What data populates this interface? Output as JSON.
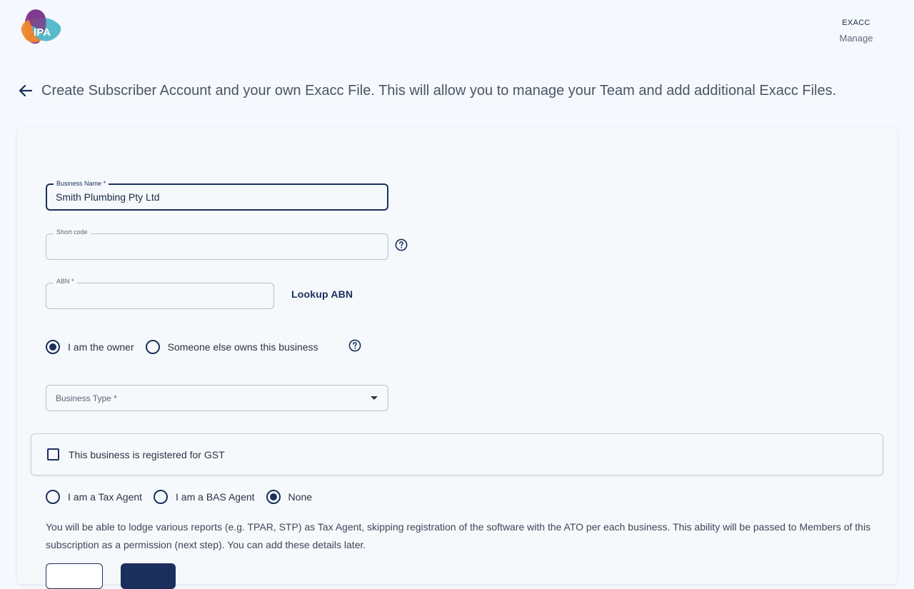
{
  "header": {
    "logo_text": "IPA",
    "org_name": "EXACC",
    "manage_link": "Manage"
  },
  "page": {
    "title": "Create Subscriber Account and your own Exacc File. This will allow you to manage your Team and add additional Exacc Files."
  },
  "form": {
    "business_name": {
      "label": "Business Name *",
      "value": "Smith Plumbing Pty Ltd"
    },
    "short_code": {
      "label": "Short code",
      "value": ""
    },
    "abn": {
      "label": "ABN *",
      "value": ""
    },
    "lookup_abn_label": "Lookup ABN",
    "ownership": {
      "options": [
        "I am the owner",
        "Someone else owns this business"
      ],
      "selected": "I am the owner"
    },
    "business_type": {
      "placeholder": "Business Type *"
    },
    "gst": {
      "label": "This business is registered for GST",
      "checked": false
    },
    "agent": {
      "options": [
        "I am a Tax Agent",
        "I am a BAS Agent",
        "None"
      ],
      "selected": "None"
    },
    "info_text": "You will be able to lodge various reports (e.g. TPAR, STP) as Tax Agent, skipping registration of the software with the ATO per each business. This ability will be passed to Members of this subscription as a permission (next step). You can add these details later."
  },
  "colors": {
    "primary": "#1b2f5c",
    "background": "#f5f8fc",
    "border": "#b9c0cb"
  },
  "icons": [
    "ipa-logo",
    "back-arrow-icon",
    "help-circle-icon",
    "caret-down-icon"
  ]
}
